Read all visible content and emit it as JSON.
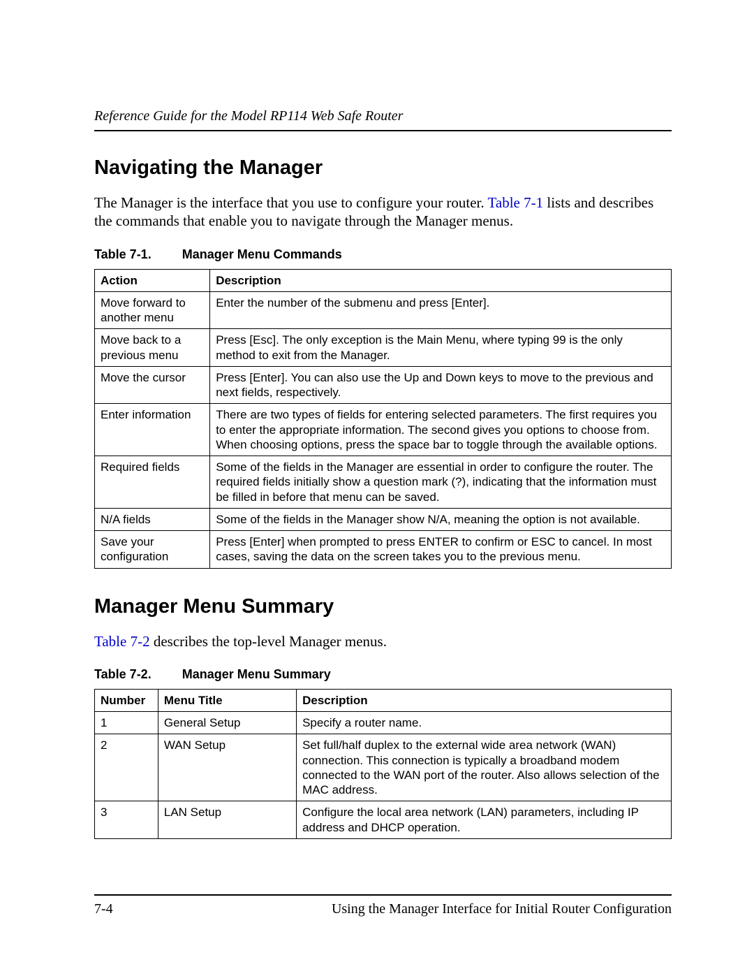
{
  "running_head": "Reference Guide for the Model RP114 Web Safe Router",
  "section1": {
    "heading": "Navigating the Manager",
    "para_pre": "The Manager is the interface that you use to configure your router. ",
    "para_link": "Table 7-1",
    "para_post": " lists and describes the commands that enable you to navigate through the Manager menus."
  },
  "table1": {
    "caption_label": "Table 7-1.",
    "caption_title": "Manager Menu Commands",
    "headers": {
      "c0": "Action",
      "c1": "Description"
    },
    "rows": [
      {
        "c0": "Move forward to another menu",
        "c1": "Enter the number of the submenu and press [Enter]."
      },
      {
        "c0": "Move back to a previous menu",
        "c1": "Press [Esc]. The only exception is the Main Menu, where typing 99 is the only method to exit from the Manager."
      },
      {
        "c0": "Move the cursor",
        "c1": "Press [Enter]. You can also use the Up and Down keys to move to the previous and next fields, respectively."
      },
      {
        "c0": "Enter information",
        "c1": "There are two types of fields for entering selected parameters. The first requires you to enter the appropriate information. The second gives you options to choose from. When choosing options, press the space bar to toggle through the available options."
      },
      {
        "c0": "Required fields",
        "c1": "Some of the fields in the Manager are essential in order to configure the router. The required fields initially show a question mark (?), indicating that the information must be filled in before that menu can be saved."
      },
      {
        "c0": "N/A fields",
        "c1": "Some of the fields in the Manager show N/A, meaning the option is not available."
      },
      {
        "c0": "Save your configuration",
        "c1": "Press [Enter] when prompted to press ENTER to confirm or ESC to cancel. In most cases, saving the data on the screen takes you to the previous menu."
      }
    ]
  },
  "section2": {
    "heading": "Manager Menu Summary",
    "para_link": "Table 7-2",
    "para_post": " describes the top-level Manager menus."
  },
  "table2": {
    "caption_label": "Table 7-2.",
    "caption_title": "Manager Menu Summary",
    "headers": {
      "c0": "Number",
      "c1": "Menu Title",
      "c2": "Description"
    },
    "rows": [
      {
        "c0": "1",
        "c1": "General Setup",
        "c2": "Specify a router name."
      },
      {
        "c0": "2",
        "c1": "WAN Setup",
        "c2": "Set full/half duplex to the external wide area network (WAN) connection. This connection is typically a broadband modem connected to the WAN port of the router. Also allows selection of the MAC address."
      },
      {
        "c0": "3",
        "c1": "LAN Setup",
        "c2": "Configure the local area network (LAN) parameters, including IP address and DHCP operation."
      }
    ]
  },
  "footer": {
    "left": "7-4",
    "right": "Using the Manager Interface for Initial Router Configuration"
  }
}
